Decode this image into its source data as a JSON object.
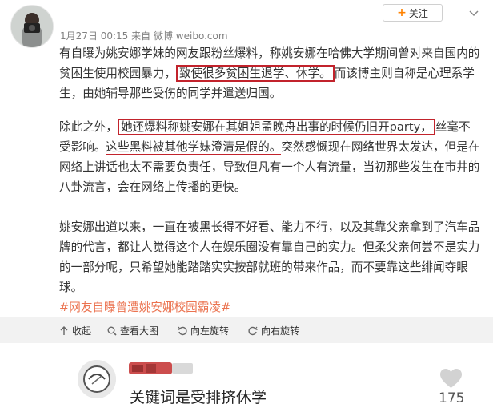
{
  "post": {
    "meta_time": "1月27日 00:15",
    "meta_from": "来自",
    "meta_source": "微博 weibo.com",
    "follow_label": "关注",
    "para1_a": "有自曝为姚安娜学妹的网友跟粉丝爆料，称姚安娜在哈佛大学期间曾对来自国内的贫困生使用校园暴力，",
    "para1_box": "致使很多贫困生退学、休学。",
    "para1_b": "而该博主则自称是心理系学生，由她辅导那些受伤的同学并遣送归国。",
    "para2_a": "除此之外，",
    "para2_box": "她还爆料称姚安娜在其姐姐孟晚舟出事的时候仍旧开party，",
    "para2_b": "丝毫不受影响。",
    "para2_ul": "这些黑料被其他学妹澄清是假的。",
    "para2_c": "突然感慨现在网络世界太发达，但是在网络上讲话也太不需要负责任，导致但凡有一个人有流量，当初那些发生在市井的八卦流言，会在网络上传播的更快。",
    "para3": "姚安娜出道以来，一直在被黑长得不好看、能力不行，以及其靠父亲拿到了汽车品牌的代言，都让人觉得这个人在娱乐圈没有靠自己的实力。但柔父亲何尝不是实力的一部分呢，只希望她能踏踏实实按部就班的带来作品，而不要靠这些绯闻夺眼球。",
    "hashtag": "#网友自曝曾遭姚安娜校园霸凌#"
  },
  "toolbar": {
    "collapse": "收起",
    "view_large": "查看大图",
    "rotate_left": "向左旋转",
    "rotate_right": "向右旋转"
  },
  "comment": {
    "text": "关键词是受排挤休学",
    "likes": "175"
  },
  "colors": {
    "highlight_red": "#c2232c",
    "hashtag_orange": "#eb7350",
    "follow_plus": "#ff8200"
  }
}
